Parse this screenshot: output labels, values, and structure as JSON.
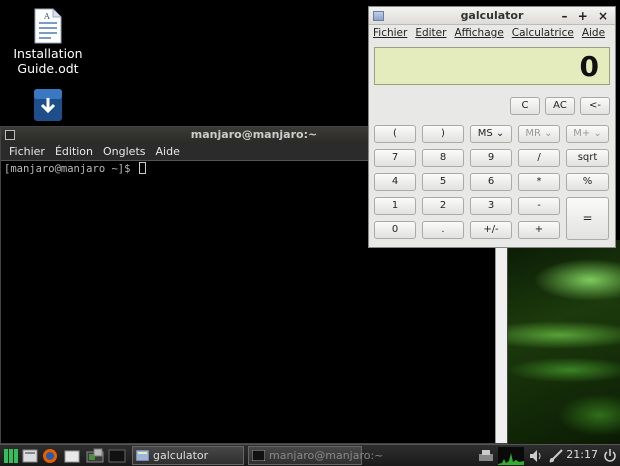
{
  "desktop": {
    "icons": [
      {
        "label_line1": "Installation",
        "label_line2": "Guide.odt",
        "icon": "document-icon"
      },
      {
        "label_line1": "",
        "label_line2": "",
        "icon": "download-icon"
      }
    ]
  },
  "terminal": {
    "title": "manjaro@manjaro:~",
    "menu": [
      "Fichier",
      "Édition",
      "Onglets",
      "Aide"
    ],
    "prompt": "[manjaro@manjaro ~]$ "
  },
  "calculator": {
    "title": "galculator",
    "title_controls": "– + ×",
    "menu": [
      "Fichier",
      "Editer",
      "Affichage",
      "Calculatrice",
      "Aide"
    ],
    "display_value": "0",
    "row0": [
      "C",
      "AC",
      "<-"
    ],
    "row1": [
      "(",
      ")",
      "MS ⌄",
      "MR ⌄",
      "M+ ⌄"
    ],
    "row2": [
      "7",
      "8",
      "9",
      "/",
      "sqrt"
    ],
    "row3": [
      "4",
      "5",
      "6",
      "*",
      "%"
    ],
    "row4": [
      "1",
      "2",
      "3",
      "-",
      "="
    ],
    "row5": [
      "0",
      ".",
      "+/-",
      "+"
    ]
  },
  "taskbar": {
    "tasks": [
      {
        "label": "galculator",
        "icon": "calculator-icon"
      },
      {
        "label": "manjaro@manjaro:~",
        "icon": "terminal-icon"
      }
    ],
    "clock": "21:17"
  }
}
